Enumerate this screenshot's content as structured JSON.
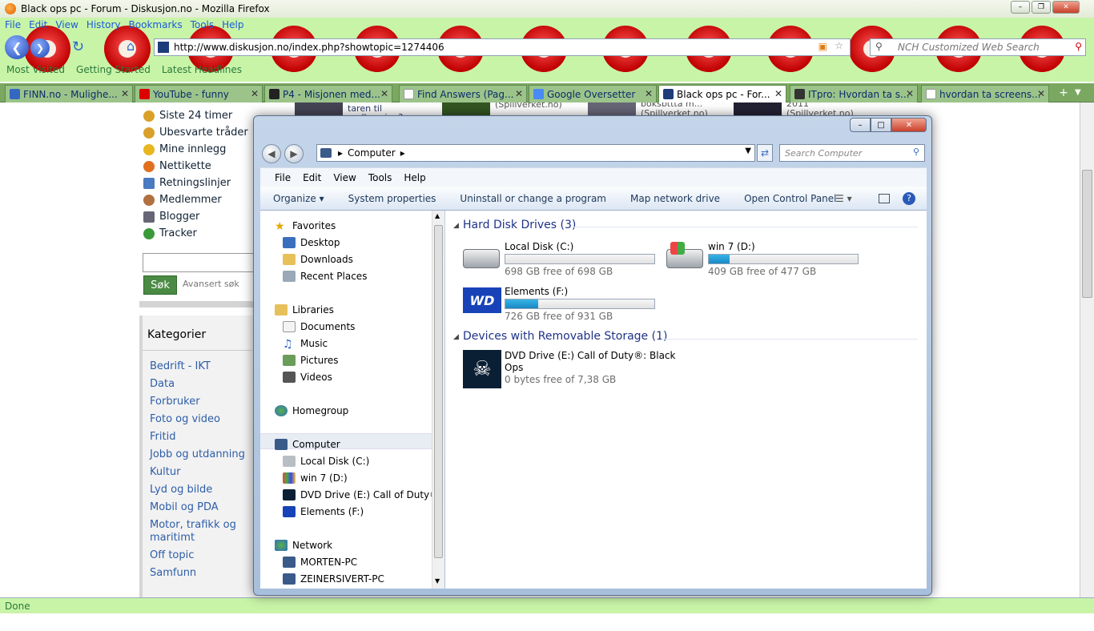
{
  "firefox": {
    "window_title": "Black ops pc - Forum - Diskusjon.no - Mozilla Firefox",
    "menu": [
      "File",
      "Edit",
      "View",
      "History",
      "Bookmarks",
      "Tools",
      "Help"
    ],
    "url": "http://www.diskusjon.no/index.php?showtopic=1274406",
    "search_placeholder": "NCH Customized Web Search",
    "bookmarks": [
      "Most Visited",
      "Getting Started",
      "Latest Headlines"
    ],
    "tabs": [
      {
        "label": "FINN.no - Mulighe..."
      },
      {
        "label": "YouTube - funny"
      },
      {
        "label": "P4 - Misjonen med..."
      },
      {
        "label": "Find Answers (Pag..."
      },
      {
        "label": "Google Oversetter"
      },
      {
        "label": "Black ops pc - For..."
      },
      {
        "label": "ITpro: Hvordan ta s..."
      },
      {
        "label": "hvordan ta screens..."
      }
    ],
    "status": "Done"
  },
  "forum": {
    "nav": [
      "Siste 24 timer",
      "Ubesvarte tråder",
      "Mine innlegg",
      "Nettikette",
      "Retningslinjer",
      "Medlemmer",
      "Blogger",
      "Tracker"
    ],
    "search_button": "Søk",
    "advanced_search": "Avansert søk",
    "categories_title": "Kategorier",
    "categories": [
      "Bedrift - IKT",
      "Data",
      "Forbruker",
      "Foto og video",
      "Fritid",
      "Jobb og utdanning",
      "Kultur",
      "Lyd og bilde",
      "Mobil og PDA",
      "Motor, trafikk og maritimt",
      "Off topic",
      "Samfunn"
    ],
    "bg_snippets": [
      "taren til melkeveien?",
      "(Spillverket.no)",
      "boksbttta m... (Spillverket.no)",
      "2011 (Spillverket.no)"
    ]
  },
  "explorer": {
    "address": "Computer",
    "search_placeholder": "Search Computer",
    "menu": [
      "File",
      "Edit",
      "View",
      "Tools",
      "Help"
    ],
    "commands": [
      "Organize",
      "System properties",
      "Uninstall or change a program",
      "Map network drive",
      "Open Control Panel"
    ],
    "tree": {
      "favorites": {
        "label": "Favorites",
        "items": [
          "Desktop",
          "Downloads",
          "Recent Places"
        ]
      },
      "libraries": {
        "label": "Libraries",
        "items": [
          "Documents",
          "Music",
          "Pictures",
          "Videos"
        ]
      },
      "homegroup": "Homegroup",
      "computer": {
        "label": "Computer",
        "items": [
          "Local Disk (C:)",
          "win 7 (D:)",
          "DVD Drive (E:) Call of Duty®: Bl",
          "Elements (F:)"
        ]
      },
      "network": {
        "label": "Network",
        "items": [
          "MORTEN-PC",
          "ZEINERSIVERT-PC"
        ]
      }
    },
    "groups": {
      "hdd": "Hard Disk Drives (3)",
      "removable": "Devices with Removable Storage (1)"
    },
    "drives": [
      {
        "name": "Local Disk (C:)",
        "free": "698 GB free of 698 GB",
        "used_fraction": 0.0
      },
      {
        "name": "win 7 (D:)",
        "free": "409 GB free of 477 GB",
        "used_fraction": 0.14
      },
      {
        "name": "Elements (F:)",
        "free": "726 GB free of 931 GB",
        "used_fraction": 0.22
      }
    ],
    "dvd": {
      "name_line1": "DVD Drive (E:) Call of Duty®: Black",
      "name_line2": "Ops",
      "free": "0 bytes free of 7,38 GB"
    },
    "colors": {
      "accent": "#1e3287",
      "bar": "#1a88c4"
    }
  }
}
